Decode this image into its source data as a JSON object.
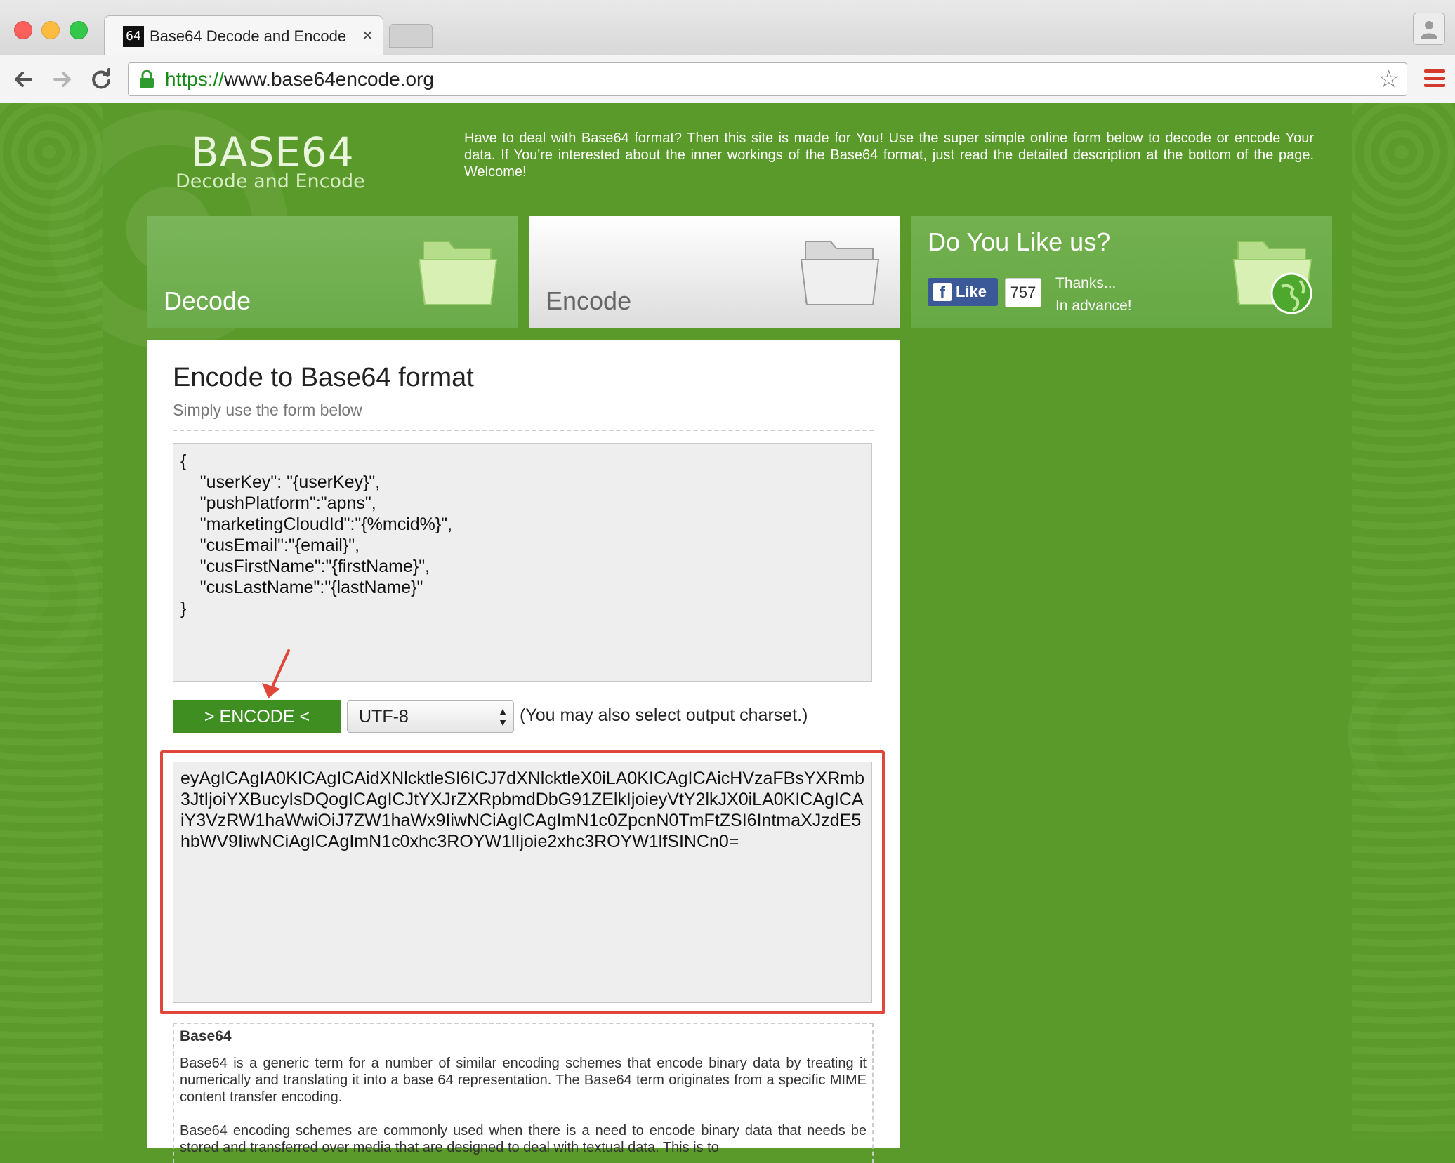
{
  "browser": {
    "tab_title": "Base64 Decode and Encode",
    "tab_favicon_text": "64",
    "tab_close": "×",
    "url_scheme": "https://",
    "url_rest": "www.base64encode.org",
    "star_icon": "☆"
  },
  "header": {
    "logo_main": "BASE64",
    "logo_sub": "Decode and Encode",
    "intro": "Have to deal with Base64 format? Then this site is made for You! Use the super simple online form below to decode or encode Your data. If You're interested about the inner workings of the Base64 format, just read the detailed description at the bottom of the page. Welcome!"
  },
  "tiles": {
    "decode_label": "Decode",
    "encode_label": "Encode",
    "like_title": "Do You Like us?",
    "fb_like_label": "Like",
    "fb_count": "757",
    "thanks_line1": "Thanks...",
    "thanks_line2": "In advance!"
  },
  "form": {
    "title": "Encode to Base64 format",
    "subtitle": "Simply use the form below",
    "input_value": "{\n    \"userKey\": \"{userKey}\",\n    \"pushPlatform\":\"apns\",\n    \"marketingCloudId\":\"{%mcid%}\",\n    \"cusEmail\":\"{email}\",\n    \"cusFirstName\":\"{firstName}\",\n    \"cusLastName\":\"{lastName}\"\n}",
    "encode_button": "> ENCODE <",
    "charset_value": "UTF-8",
    "charset_note": "(You may also select output charset.)",
    "output_value": "eyAgICAgIA0KICAgICAidXNlcktleSI6ICJ7dXNlcktleX0iLA0KICAgICAicHVzaFBsYXRmb3JtIjoiYXBucyIsDQogICAgICJtYXJrZXRpbmdDbG91ZElkIjoieyVtY2lkJX0iLA0KICAgICAiY3VzRW1haWwiOiJ7ZW1haWx9IiwNCiAgICAgImN1c0ZpcnN0TmFtZSI6IntmaXJzdE5hbWV9IiwNCiAgICAgImN1c0xhc3ROYW1lIjoie2xhc3ROYW1lfSINCn0="
  },
  "description": {
    "title": "Base64",
    "para1": "Base64 is a generic term for a number of similar encoding schemes that encode binary data by treating it numerically and translating it into a base 64 representation. The Base64 term originates from a specific MIME content transfer encoding.",
    "para2": "Base64 encoding schemes are commonly used when there is a need to encode binary data that needs be stored and transferred over media that are designed to deal with textual data. This is to"
  },
  "colors": {
    "page_green": "#5a9a2a",
    "button_green": "#3e8e22",
    "highlight_red": "#e0473a",
    "url_green": "#1a8a1a",
    "facebook_blue": "#3b5998"
  }
}
